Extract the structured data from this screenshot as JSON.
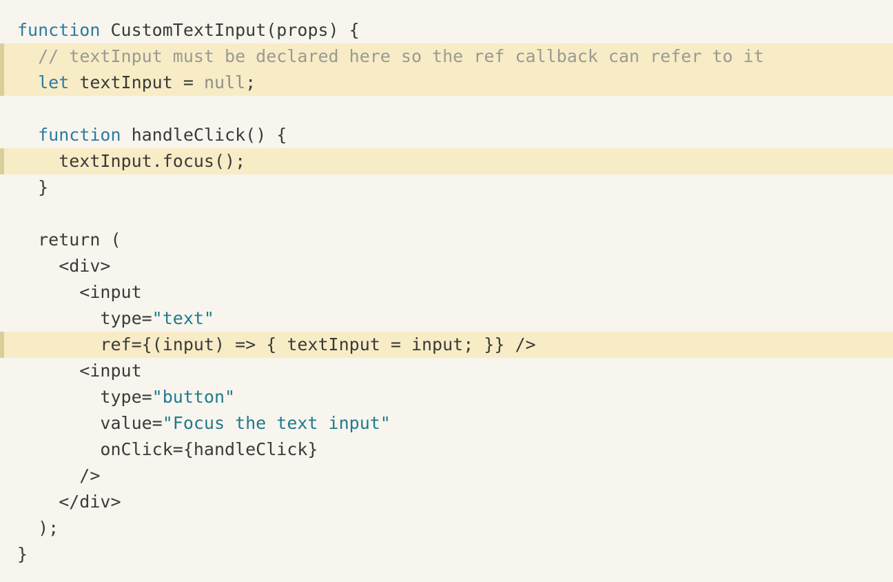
{
  "code": {
    "lines": [
      {
        "highlighted": false,
        "tokens": [
          [
            "kw",
            "function"
          ],
          [
            "pl",
            " CustomTextInput(props) {"
          ]
        ]
      },
      {
        "highlighted": true,
        "tokens": [
          [
            "pl",
            "  "
          ],
          [
            "cm",
            "// textInput must be declared here so the ref callback can refer to it"
          ]
        ]
      },
      {
        "highlighted": true,
        "tokens": [
          [
            "pl",
            "  "
          ],
          [
            "kw",
            "let"
          ],
          [
            "pl",
            " textInput = "
          ],
          [
            "nu",
            "null"
          ],
          [
            "pl",
            ";"
          ]
        ]
      },
      {
        "highlighted": false,
        "tokens": []
      },
      {
        "highlighted": false,
        "tokens": [
          [
            "pl",
            "  "
          ],
          [
            "kw",
            "function"
          ],
          [
            "pl",
            " handleClick() {"
          ]
        ]
      },
      {
        "highlighted": true,
        "tokens": [
          [
            "pl",
            "    textInput.focus();"
          ]
        ]
      },
      {
        "highlighted": false,
        "tokens": [
          [
            "pl",
            "  }"
          ]
        ]
      },
      {
        "highlighted": false,
        "tokens": []
      },
      {
        "highlighted": false,
        "tokens": [
          [
            "pl",
            "  return ("
          ]
        ]
      },
      {
        "highlighted": false,
        "tokens": [
          [
            "tg",
            "    <div>"
          ]
        ]
      },
      {
        "highlighted": false,
        "tokens": [
          [
            "tg",
            "      <input"
          ]
        ]
      },
      {
        "highlighted": false,
        "tokens": [
          [
            "pl",
            "        type="
          ],
          [
            "st",
            "\"text\""
          ]
        ]
      },
      {
        "highlighted": true,
        "tokens": [
          [
            "pl",
            "        ref={(input) => { textInput = input; }} />"
          ]
        ]
      },
      {
        "highlighted": false,
        "tokens": [
          [
            "tg",
            "      <input"
          ]
        ]
      },
      {
        "highlighted": false,
        "tokens": [
          [
            "pl",
            "        type="
          ],
          [
            "st",
            "\"button\""
          ]
        ]
      },
      {
        "highlighted": false,
        "tokens": [
          [
            "pl",
            "        value="
          ],
          [
            "st",
            "\"Focus the text input\""
          ]
        ]
      },
      {
        "highlighted": false,
        "tokens": [
          [
            "pl",
            "        onClick={handleClick}"
          ]
        ]
      },
      {
        "highlighted": false,
        "tokens": [
          [
            "tg",
            "      />"
          ]
        ]
      },
      {
        "highlighted": false,
        "tokens": [
          [
            "tg",
            "    </div>"
          ]
        ]
      },
      {
        "highlighted": false,
        "tokens": [
          [
            "pl",
            "  );"
          ]
        ]
      },
      {
        "highlighted": false,
        "tokens": [
          [
            "pl",
            "}"
          ]
        ]
      }
    ]
  },
  "colors": {
    "background": "#f7f5ee",
    "highlight": "#f7ecc6",
    "keyword": "#2e7aa0",
    "comment": "#9a9a92",
    "string": "#1f7a8c"
  }
}
